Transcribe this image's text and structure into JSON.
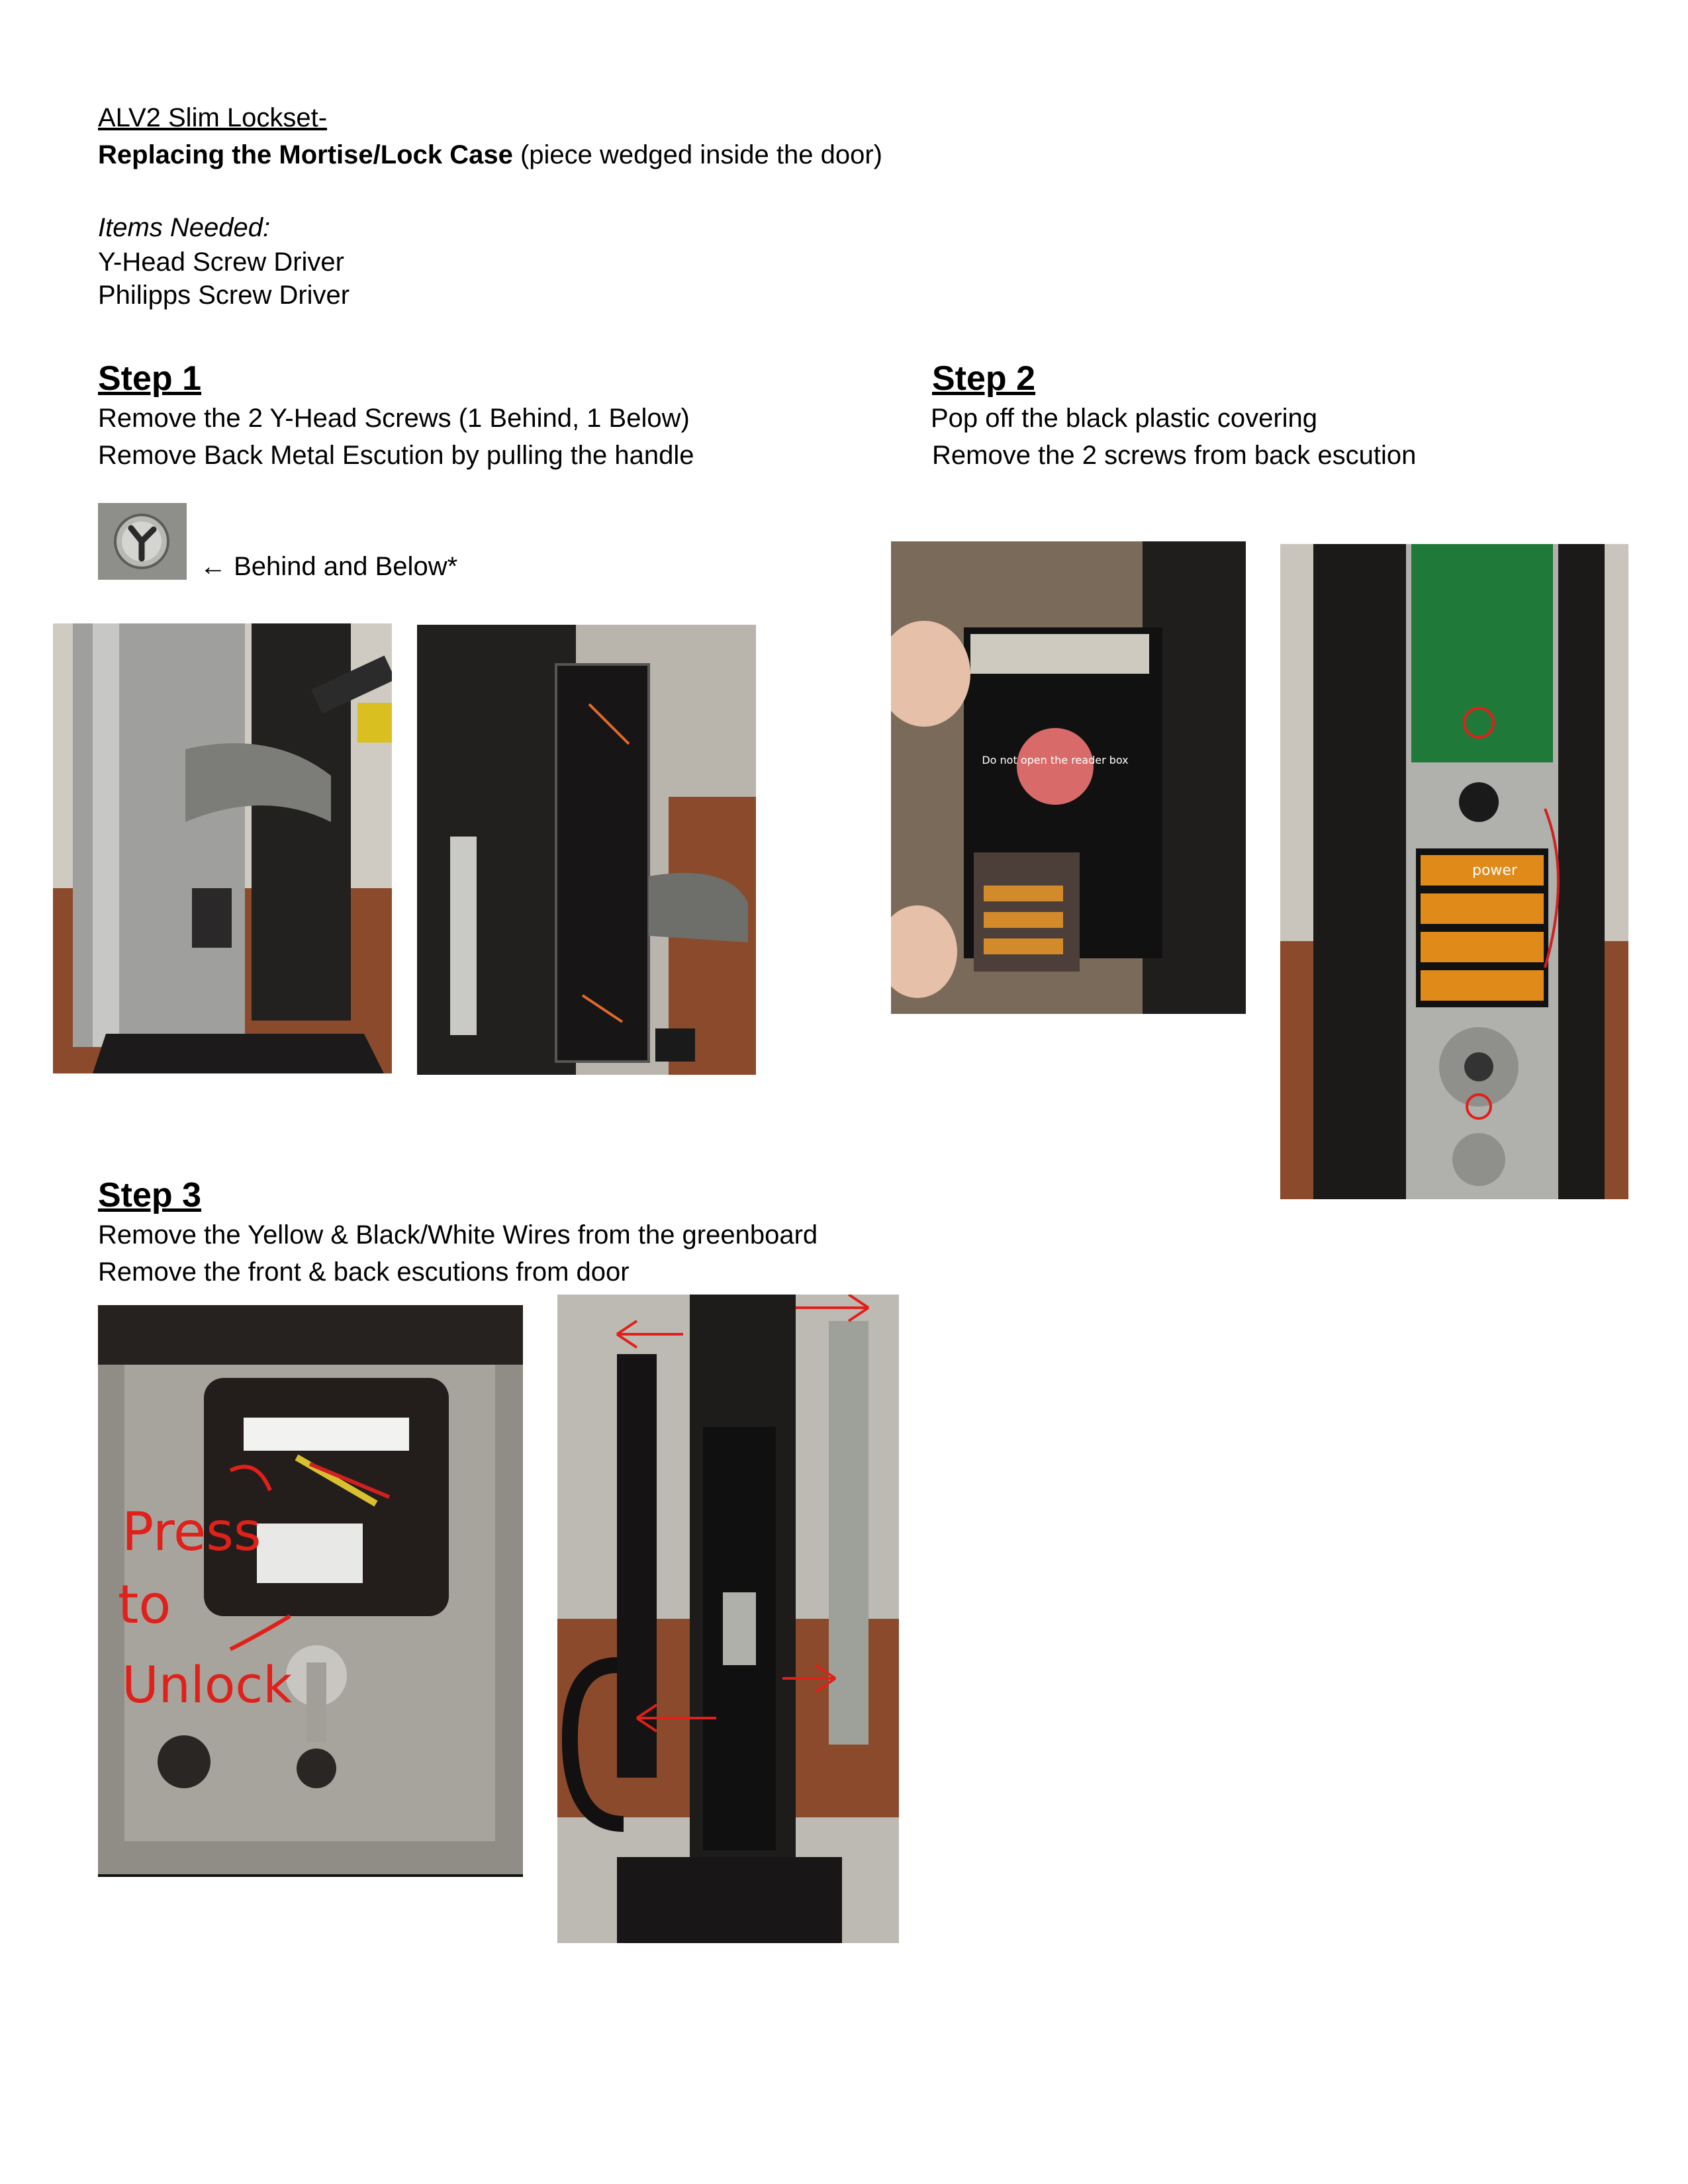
{
  "header": {
    "title": "ALV2 Slim Lockset-",
    "subtitle_bold": "Replacing the Mortise/Lock Case",
    "subtitle_rest": " (piece wedged inside the door)"
  },
  "items": {
    "label": "Items Needed:",
    "list": [
      "Y-Head Screw Driver",
      "Philipps Screw Driver"
    ]
  },
  "step1": {
    "heading": "Step 1",
    "lines": [
      "Remove the 2 Y-Head Screws (1 Behind, 1 Below)",
      "Remove Back Metal Escution by pulling the handle"
    ],
    "arrow_note": "← Behind and Below*"
  },
  "step2": {
    "heading": "Step 2",
    "lines": [
      "Pop off the black plastic covering",
      "Remove the 2 screws from back escution"
    ],
    "sticker_text": "Do not open the reader box",
    "battery_brand": "power"
  },
  "step3": {
    "heading": "Step 3",
    "lines": [
      "Remove the Yellow & Black/White Wires from the greenboard",
      "Remove the front & back escutions from door"
    ],
    "handwriting": [
      "Press",
      "to",
      "Unlock"
    ]
  },
  "colors": {
    "annotation_red": "#e0201a",
    "door_dark": "#1e1c1c",
    "steel": "#a8a8a6",
    "table": "#8b4a2b"
  }
}
